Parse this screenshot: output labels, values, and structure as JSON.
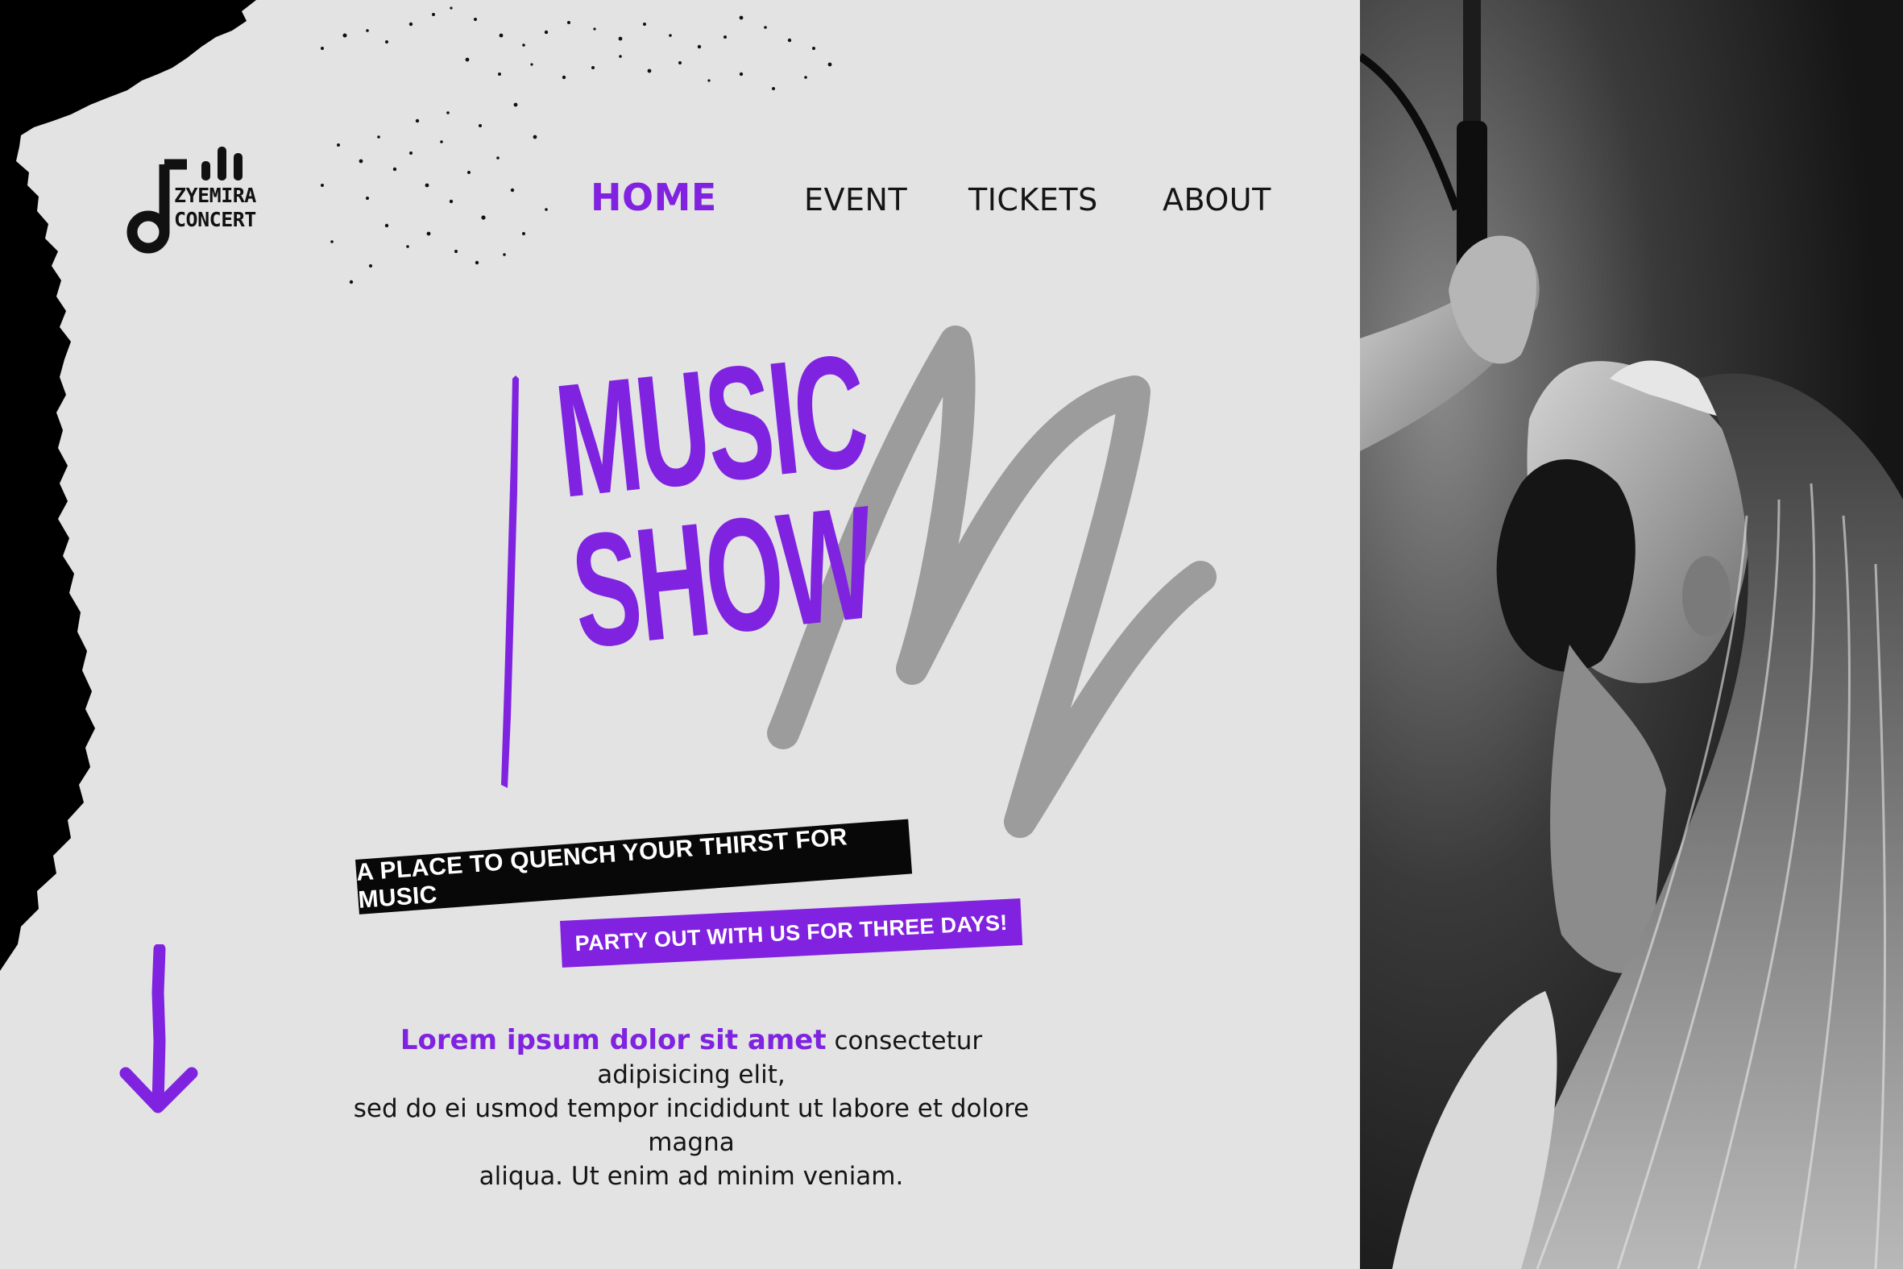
{
  "brand": {
    "logo_line1": "ZYEMIRA",
    "logo_line2": "CONCERT"
  },
  "nav": {
    "items": [
      {
        "label": "HOME",
        "active": true
      },
      {
        "label": "EVENT",
        "active": false
      },
      {
        "label": "TICKETS",
        "active": false
      },
      {
        "label": "ABOUT",
        "active": false
      }
    ]
  },
  "hero": {
    "title_line1": "MUSIC",
    "title_line2": "SHOW",
    "tagline_primary": "A PLACE TO QUENCH YOUR THIRST FOR MUSIC",
    "tagline_secondary": "PARTY OUT WITH US FOR THREE DAYS!"
  },
  "intro": {
    "highlight": "Lorem ipsum dolor sit amet",
    "body_line1": " consectetur adipisicing elit,",
    "body_line2": "sed do ei usmod tempor incididunt ut labore et dolore magna",
    "body_line3": "aliqua. Ut enim ad minim veniam."
  },
  "icons": {
    "logo": "music-note-bars-icon",
    "scroll": "arrow-down-icon",
    "decor": "m-scribble-icon"
  },
  "colors": {
    "accent": "#8122e0",
    "background": "#e3e3e4",
    "dark": "#080808",
    "scribble": "#9c9c9c"
  }
}
